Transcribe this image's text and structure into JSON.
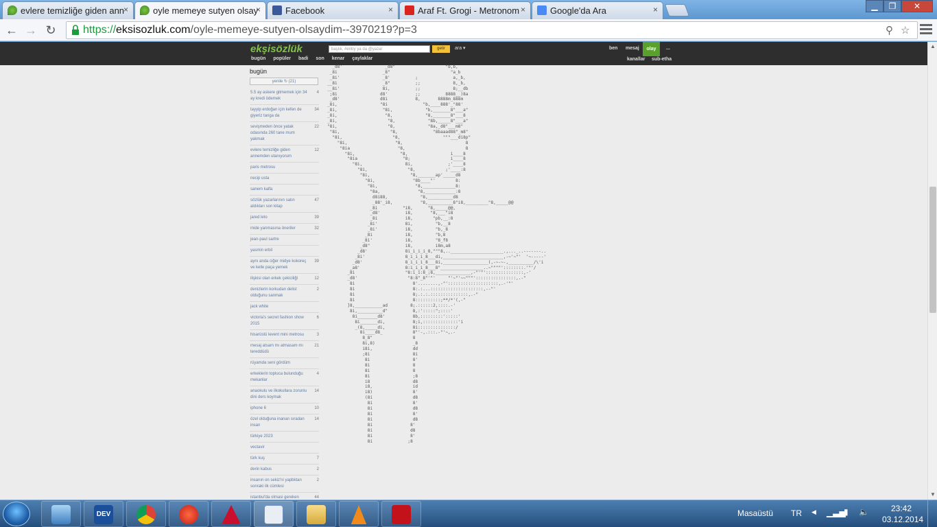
{
  "browser": {
    "tabs": [
      {
        "title": "evlere temizliğe giden ann",
        "icon": "eksi-drop-icon",
        "active": false
      },
      {
        "title": "oyle memeye sutyen olsay",
        "icon": "eksi-drop-icon",
        "active": true
      },
      {
        "title": "Facebook",
        "icon": "facebook-icon",
        "active": false
      },
      {
        "title": "Araf Ft. Grogi - Metronom",
        "icon": "youtube-icon",
        "active": false
      },
      {
        "title": "Google'da Ara",
        "icon": "google-icon",
        "active": false
      }
    ],
    "url_scheme": "https://",
    "url_host": "eksisozluk.com",
    "url_path": "/oyle-memeye-sutyen-olsaydim--3970219?p=3",
    "tab_close": "×",
    "window_buttons": {
      "minimize": "▁",
      "maximize": "❐",
      "close": "✕"
    }
  },
  "site": {
    "logo": "ekşisözlük",
    "search_placeholder": "başlık, #entry ya da @yazar",
    "search_button": "getir",
    "ara_label": "ara ▾",
    "nav": [
      "bugün",
      "popüler",
      "badi",
      "son",
      "kenar",
      "çaylaklar"
    ],
    "user_links": {
      "ben": "ben",
      "mesaj": "mesaj",
      "olay": "olay",
      "more": "..."
    },
    "sub_links": {
      "kanallar": "kanallar",
      "sub_etha": "sub-etha"
    }
  },
  "sidebar": {
    "title": "bugün",
    "refresh": "yenile ↻ (21)",
    "topics": [
      {
        "title": "5.5 ay askere gitmemek için 34 ay kredi ödemek",
        "count": "4"
      },
      {
        "title": "tayyip erdoğan için kefen de giyeriz tanga da",
        "count": "34"
      },
      {
        "title": "sevişmeden önce yatak odasında 260 tane mum yakmak",
        "count": "22"
      },
      {
        "title": "evlere temizliğe giden annemden utanıyorum",
        "count": "12"
      },
      {
        "title": "paris metrosu",
        "count": ""
      },
      {
        "title": "necip usta",
        "count": ""
      },
      {
        "title": "sanem kalfa",
        "count": ""
      },
      {
        "title": "sözlük yazarlarının satın aldıkları son kitap",
        "count": "47"
      },
      {
        "title": "jared leto",
        "count": "39"
      },
      {
        "title": "mide yanmasına öneriler",
        "count": "32"
      },
      {
        "title": "jean-paul sartre",
        "count": ""
      },
      {
        "title": "yasmin erbil",
        "count": ""
      },
      {
        "title": "aynı anda ciğer midye kokoreç ve kelle paça yemek",
        "count": "39"
      },
      {
        "title": "ilişkisi olan erkek çekiciliği",
        "count": "12"
      },
      {
        "title": "denizlerin korkudan delist olduğunu sanmak",
        "count": "2"
      },
      {
        "title": "jack white",
        "count": ""
      },
      {
        "title": "victoria's secret fashion show 2015",
        "count": "6"
      },
      {
        "title": "hisarüstü levent mini metrosu",
        "count": "3"
      },
      {
        "title": "mesaj atsam mı atmasam mı tereddüdü",
        "count": "21"
      },
      {
        "title": "rüyamda seni gördüm",
        "count": ""
      },
      {
        "title": "erkeklerin topluca bulunduğu mekanlar",
        "count": "4"
      },
      {
        "title": "anaokulu ve ilkokullara zorunlu dini ders koymak",
        "count": "14"
      },
      {
        "title": "iphone 6",
        "count": "10"
      },
      {
        "title": "özel olduğuna inanan sıradan insan",
        "count": "14"
      },
      {
        "title": "türkiye 2023",
        "count": ""
      },
      {
        "title": "vectavir",
        "count": ""
      },
      {
        "title": "türk kuş",
        "count": "7"
      },
      {
        "title": "derin kabus",
        "count": "2"
      },
      {
        "title": "insanın on sekiz'ni yapbktan sonraki ilk cümlesi",
        "count": "2"
      },
      {
        "title": "istanbul'da olmasi gereken metro hattı",
        "count": "44"
      }
    ]
  },
  "taskbar": {
    "apps": [
      {
        "name": "virtualbox",
        "label": ""
      },
      {
        "name": "devcpp",
        "label": "DEV"
      },
      {
        "name": "chrome",
        "label": ""
      },
      {
        "name": "ccleaner",
        "label": ""
      },
      {
        "name": "autocad",
        "label": ""
      },
      {
        "name": "wordpad",
        "label": ""
      },
      {
        "name": "explorer",
        "label": ""
      },
      {
        "name": "vlc",
        "label": ""
      },
      {
        "name": "acrobat",
        "label": ""
      }
    ],
    "desktop_label": "Masaüstü",
    "lang": "TR",
    "time": "23:42",
    "date": "03.12.2014"
  }
}
